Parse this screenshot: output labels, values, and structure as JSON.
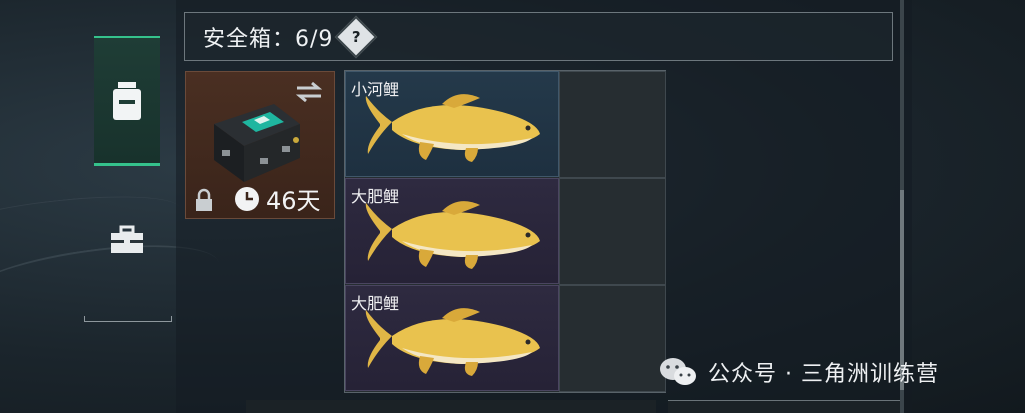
{
  "header": {
    "title": "安全箱：6/9",
    "help_label": "?"
  },
  "sidebar": {
    "tabs": [
      {
        "name": "safe-box-tab",
        "icon": "backpack-icon",
        "active": true
      },
      {
        "name": "toolbox-tab",
        "icon": "toolbox-icon",
        "active": false
      }
    ]
  },
  "safe_case": {
    "icon": "safe-case-image",
    "duration": "46天",
    "locked": true
  },
  "grid": {
    "items": [
      {
        "label": "小河鲤",
        "rarity_color": "#2a4256"
      },
      {
        "label": "大肥鲤",
        "rarity_color": "#322d46"
      },
      {
        "label": "大肥鲤",
        "rarity_color": "#322d46"
      }
    ]
  },
  "watermark": {
    "text": "公众号 · 三角洲训练营"
  },
  "colors": {
    "accent": "#35c28c",
    "background": "#1b252c"
  }
}
